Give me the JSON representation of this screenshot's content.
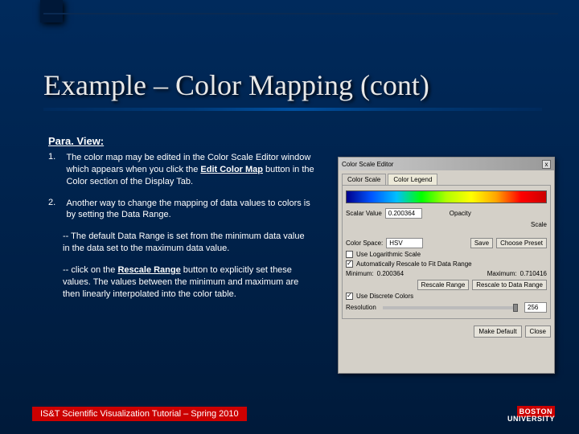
{
  "slide": {
    "title": "Example – Color Mapping (cont)",
    "subhead": "Para. View:",
    "item1_num": "1.",
    "item1_a": "The color map may be edited in the Color Scale Editor window which appears when you click the ",
    "item1_u": "Edit Color Map",
    "item1_b": " button in the Color section of the Display Tab.",
    "item2_num": "2.",
    "item2": "Another way to change the mapping of data values to colors is by setting the Data Range.",
    "note1": "-- The default Data Range is set from the minimum data value in the data set to the maximum data value.",
    "note2_a": "-- click on the ",
    "note2_u": "Rescale Range",
    "note2_b": " button to explicitly set these values. The values between the minimum and maximum are then linearly interpolated into the color table.",
    "footer": "IS&T Scientific Visualization Tutorial – Spring 2010",
    "logo_top": "BOSTON",
    "logo_bot": "UNIVERSITY"
  },
  "panel": {
    "title": "Color Scale Editor",
    "close": "x",
    "tab1": "Color Scale",
    "tab2": "Color Legend",
    "scalar_lbl": "Scalar Value",
    "scalar_val": "0.200364",
    "opacity_lbl": "Opacity",
    "scale_lbl": "Scale",
    "colorspace_lbl": "Color Space:",
    "colorspace_val": "HSV",
    "save_btn": "Save",
    "choose_btn": "Choose Preset",
    "logscale": "Use Logarithmic Scale",
    "autorescale": "Automatically Rescale to Fit Data Range",
    "min_lbl": "Minimum:",
    "min_val": "0.200364",
    "max_lbl": "Maximum:",
    "max_val": "0.710416",
    "rescale_range": "Rescale Range",
    "rescale_data": "Rescale to Data Range",
    "discrete": "Use Discrete Colors",
    "res_lbl": "Resolution",
    "res_val": "256",
    "make_default": "Make Default",
    "close_btn": "Close"
  }
}
